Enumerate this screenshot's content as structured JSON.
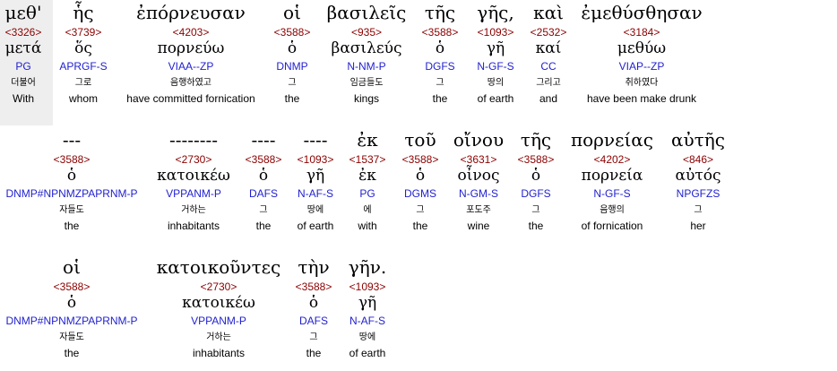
{
  "words": [
    {
      "greek": "μεθ'",
      "strong": "<3326>",
      "lemma": "μετά",
      "morph": "PG",
      "kor": "더불어",
      "eng": "With"
    },
    {
      "greek": "ἧς",
      "strong": "<3739>",
      "lemma": "ὅς",
      "morph": "APRGF-S",
      "kor": "그로",
      "eng": "whom"
    },
    {
      "greek": "ἐπόρνευσαν",
      "strong": "<4203>",
      "lemma": "πορνεύω",
      "morph": "VIAA--ZP",
      "kor": "음행하였고",
      "eng": "have committed fornication"
    },
    {
      "greek": "οἱ",
      "strong": "<3588>",
      "lemma": "ὁ",
      "morph": "DNMP",
      "kor": "그",
      "eng": "the"
    },
    {
      "greek": "βασιλεῖς",
      "strong": "<935>",
      "lemma": "βασιλεύς",
      "morph": "N-NM-P",
      "kor": "임금들도",
      "eng": "kings"
    },
    {
      "greek": "τῆς",
      "strong": "<3588>",
      "lemma": "ὁ",
      "morph": "DGFS",
      "kor": "그",
      "eng": "the"
    },
    {
      "greek": "γῆς,",
      "strong": "<1093>",
      "lemma": "γῆ",
      "morph": "N-GF-S",
      "kor": "땅의",
      "eng": "of earth"
    },
    {
      "greek": "καὶ",
      "strong": "<2532>",
      "lemma": "καί",
      "morph": "CC",
      "kor": "그리고",
      "eng": "and"
    },
    {
      "greek": "ἐμεθύσθησαν",
      "strong": "<3184>",
      "lemma": "μεθύω",
      "morph": "VIAP--ZP",
      "kor": "취하였다",
      "eng": "have been make drunk"
    },
    {
      "greek": "---",
      "strong": "<3588>",
      "lemma": "ὁ",
      "morph": "DNMP#NPNMZPAPRNM-P",
      "kor": "자들도",
      "eng": "the"
    },
    {
      "greek": "--------",
      "strong": "<2730>",
      "lemma": "κατοικέω",
      "morph": "VPPANM-P",
      "kor": "거하는",
      "eng": "inhabitants"
    },
    {
      "greek": "----",
      "strong": "<3588>",
      "lemma": "ὁ",
      "morph": "DAFS",
      "kor": "그",
      "eng": "the"
    },
    {
      "greek": "----",
      "strong": "<1093>",
      "lemma": "γῆ",
      "morph": "N-AF-S",
      "kor": "땅에",
      "eng": "of earth"
    },
    {
      "greek": "ἐκ",
      "strong": "<1537>",
      "lemma": "ἐκ",
      "morph": "PG",
      "kor": "에",
      "eng": "with"
    },
    {
      "greek": "τοῦ",
      "strong": "<3588>",
      "lemma": "ὁ",
      "morph": "DGMS",
      "kor": "그",
      "eng": "the"
    },
    {
      "greek": "οἴνου",
      "strong": "<3631>",
      "lemma": "οἶνος",
      "morph": "N-GM-S",
      "kor": "포도주",
      "eng": "wine"
    },
    {
      "greek": "τῆς",
      "strong": "<3588>",
      "lemma": "ὁ",
      "morph": "DGFS",
      "kor": "그",
      "eng": "the"
    },
    {
      "greek": "πορνείας",
      "strong": "<4202>",
      "lemma": "πορνεία",
      "morph": "N-GF-S",
      "kor": "음행의",
      "eng": "of fornication"
    },
    {
      "greek": "αὐτῆς",
      "strong": "<846>",
      "lemma": "αὐτός",
      "morph": "NPGFZS",
      "kor": "그",
      "eng": "her"
    },
    {
      "greek": "οἱ",
      "strong": "<3588>",
      "lemma": "ὁ",
      "morph": "DNMP#NPNMZPAPRNM-P",
      "kor": "자들도",
      "eng": "the"
    },
    {
      "greek": "κατοικοῦντες",
      "strong": "<2730>",
      "lemma": "κατοικέω",
      "morph": "VPPANM-P",
      "kor": "거하는",
      "eng": "inhabitants"
    },
    {
      "greek": "τὴν",
      "strong": "<3588>",
      "lemma": "ὁ",
      "morph": "DAFS",
      "kor": "그",
      "eng": "the"
    },
    {
      "greek": "γῆν.",
      "strong": "<1093>",
      "lemma": "γῆ",
      "morph": "N-AF-S",
      "kor": "땅에",
      "eng": "of earth"
    }
  ]
}
